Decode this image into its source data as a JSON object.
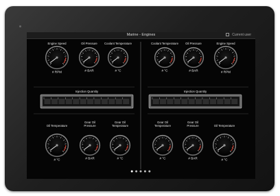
{
  "window": {
    "title": "Marine - Engines",
    "user_label": "Current user"
  },
  "panels": [
    {
      "top_gauges": [
        {
          "label": "Engine Speed",
          "unit": "# RPM"
        },
        {
          "label": "Oil Pressure",
          "unit": "# BAR"
        },
        {
          "label": "Coolant Temperature",
          "unit": "# °C"
        }
      ],
      "injection_label": "Injection Quantity",
      "bottom_gauges": [
        {
          "label": "Oil Temperature",
          "unit": "# °C"
        },
        {
          "label": "Gear Oil\nPressure",
          "unit": "# BAR"
        },
        {
          "label": "Gear Oil\nTemperature",
          "unit": "# °C"
        }
      ]
    },
    {
      "top_gauges": [
        {
          "label": "Coolant Temperature",
          "unit": "# °C"
        },
        {
          "label": "Oil Pressure",
          "unit": "# BAR"
        },
        {
          "label": "Engine Speed",
          "unit": "# RPM"
        }
      ],
      "injection_label": "Injection Quantity",
      "bottom_gauges": [
        {
          "label": "Gear Oil\nTemperature",
          "unit": "# °C"
        },
        {
          "label": "Gear Oil\nPressure",
          "unit": "# BAR"
        },
        {
          "label": "Oil Temperature",
          "unit": "# °C"
        }
      ]
    }
  ],
  "pager": {
    "count": 5,
    "active": 0
  }
}
